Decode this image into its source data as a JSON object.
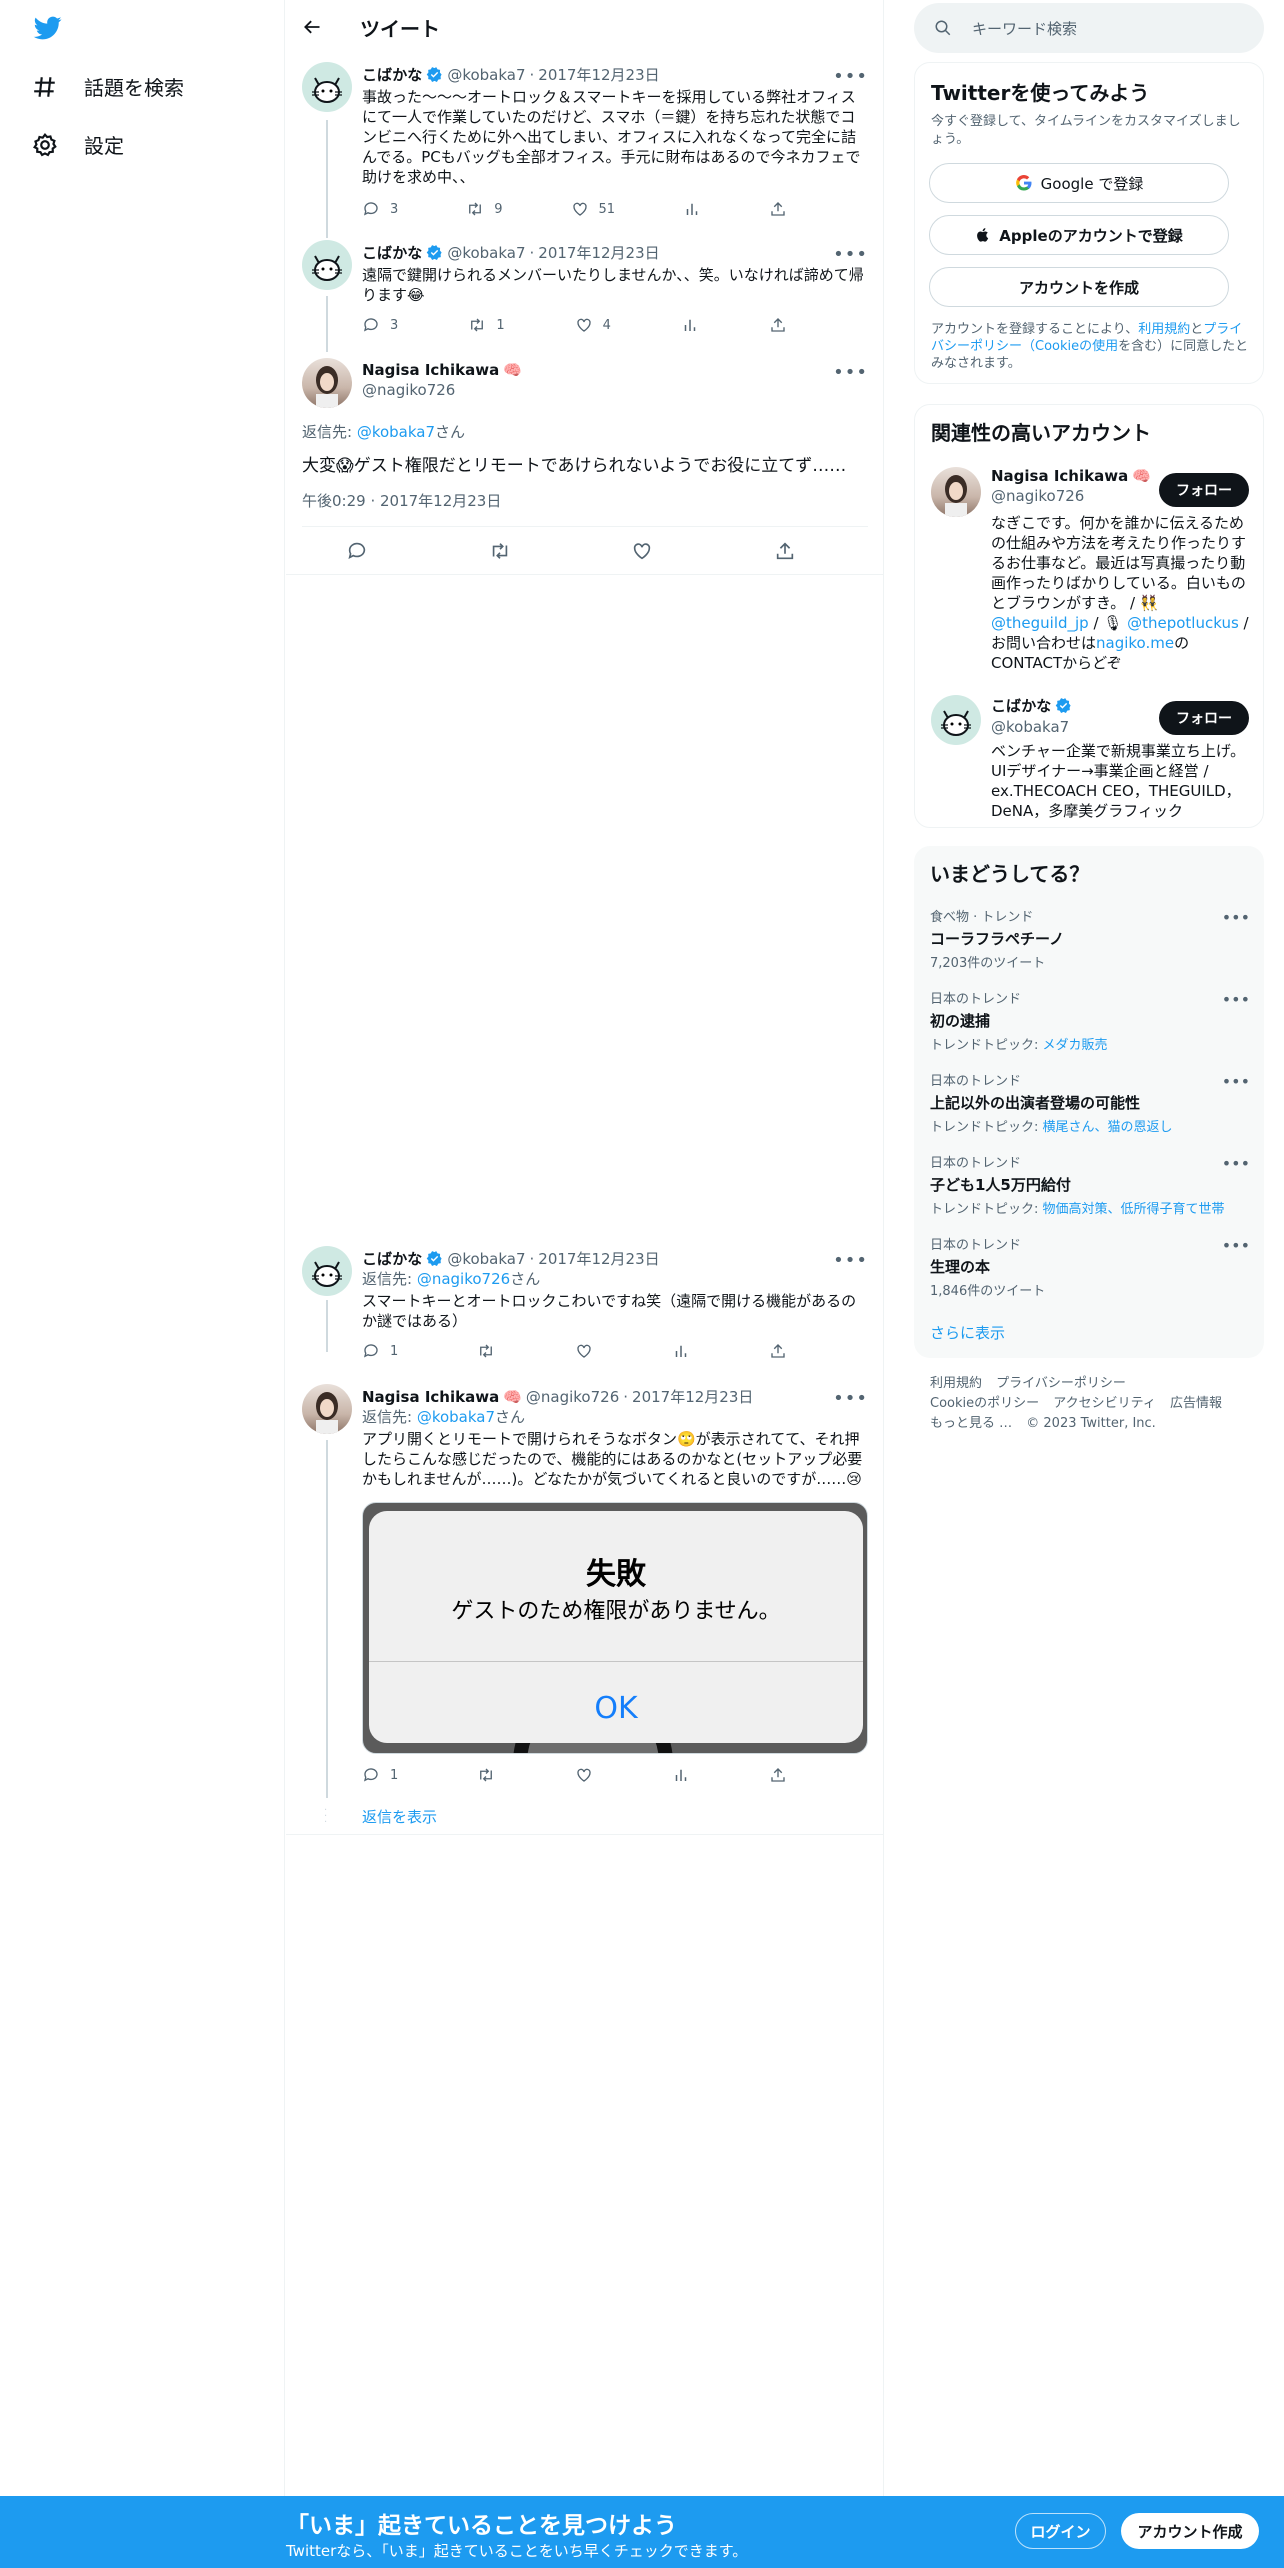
{
  "nav": {
    "explore_label": "話題を検索",
    "settings_label": "設定"
  },
  "header": {
    "title": "ツイート"
  },
  "tweets": [
    {
      "name": "こばかな",
      "handle": "@kobaka7",
      "date": "2017年12月23日",
      "text": "事故った〜〜〜オートロック＆スマートキーを採用している弊社オフィスにて一人で作業していたのだけど、スマホ（＝鍵）を持ち忘れた状態でコンビニへ行くために外へ出てしまい、オフィスに入れなくなって完全に詰んでる。PCもバッグも全部オフィス。手元に財布はあるので今ネカフェで助けを求め中、、",
      "replies": "3",
      "retweets": "9",
      "likes": "51"
    },
    {
      "name": "こばかな",
      "handle": "@kobaka7",
      "date": "2017年12月23日",
      "text": "遠隔で鍵開けられるメンバーいたりしませんか、、笑。いなければ諦めて帰ります😂",
      "replies": "3",
      "retweets": "1",
      "likes": "4"
    }
  ],
  "focus": {
    "name": "Nagisa Ichikawa",
    "emoji": "🧠",
    "handle": "@nagiko726",
    "reply_prefix": "返信先: ",
    "reply_to": "@kobaka7",
    "reply_suffix": "さん",
    "text": "大変😱ゲスト権限だとリモートであけられないようでお役に立てず……",
    "time": "午後0:29 · 2017年12月23日"
  },
  "replies": [
    {
      "name": "こばかな",
      "handle": "@kobaka7",
      "date": "2017年12月23日",
      "reply_prefix": "返信先: ",
      "reply_to": "@nagiko726",
      "reply_suffix": "さん",
      "text": "スマートキーとオートロックこわいですね笑（遠隔で開ける機能があるのか謎ではある）",
      "replies": "1"
    },
    {
      "name": "Nagisa Ichikawa",
      "emoji": "🧠",
      "handle": "@nagiko726",
      "date": "2017年12月23日",
      "reply_prefix": "返信先: ",
      "reply_to": "@kobaka7",
      "reply_suffix": "さん",
      "text": "アプリ開くとリモートで開けられそうなボタン🙄が表示されてて、それ押したらこんな感じだったので、機能的にはあるのかなと(セットアップ必要かもしれませんが……)。どなたかが気づいてくれると良いのですが……😢",
      "replies": "1",
      "media": {
        "alert_title": "失敗",
        "alert_message": "ゲストのため権限がありません。",
        "alert_button": "OK"
      }
    }
  ],
  "show_replies": "返信を表示",
  "search": {
    "placeholder": "キーワード検索"
  },
  "signup": {
    "title": "Twitterを使ってみよう",
    "subtitle": "今すぐ登録して、タイムラインをカスタマイズしましょう。",
    "google": "Google で登録",
    "apple": "Appleのアカウントで登録",
    "create": "アカウントを作成",
    "legal_1": "アカウントを登録することにより、",
    "legal_link_1": "利用規約",
    "legal_2": "と",
    "legal_link_2": "プライバシーポリシー（Cookieの使用",
    "legal_3": "を含む）に同意したとみなされます。"
  },
  "related": {
    "title": "関連性の高いアカウント",
    "accounts": [
      {
        "name": "Nagisa Ichikawa",
        "emoji": "🧠",
        "handle": "@nagiko726",
        "follow": "フォロー",
        "bio_1": "なぎこです。何かを誰かに伝えるための仕組みや方法を考えたり作ったりするお仕事など。最近は写真撮ったり動画作ったりばかりしている。白いものとブラウンがすき。 / 👯 ",
        "bio_link_1": "@theguild_jp",
        "bio_2": " / 🎙 ",
        "bio_link_2": "@thepotluckus",
        "bio_3": " / お問い合わせは",
        "bio_link_3": "nagiko.me",
        "bio_4": "のCONTACTからどぞ"
      },
      {
        "name": "こばかな",
        "handle": "@kobaka7",
        "follow": "フォロー",
        "bio": "ベンチャー企業で新規事業立ち上げ。UIデザイナー→事業企画と経営 / ex.THECOACH CEO，THEGUILD，DeNA，多摩美グラフィック"
      }
    ]
  },
  "trends": {
    "title": "いまどうしてる？",
    "items": [
      {
        "context": "食べ物 · トレンド",
        "name": "コーラフラペチーノ",
        "extra": "7,203件のツイート"
      },
      {
        "context": "日本のトレンド",
        "name": "初の逮捕",
        "extra_prefix": "トレンドトピック: ",
        "extra_link": "メダカ販売"
      },
      {
        "context": "日本のトレンド",
        "name": "上記以外の出演者登場の可能性",
        "extra_prefix": "トレンドトピック: ",
        "extra_link": "横尾さん、猫の恩返し"
      },
      {
        "context": "日本のトレンド",
        "name": "子ども1人5万円給付",
        "extra_prefix": "トレンドトピック: ",
        "extra_link": "物価高対策、低所得子育て世帯"
      },
      {
        "context": "日本のトレンド",
        "name": "生理の本",
        "extra": "1,846件のツイート"
      }
    ],
    "show_more": "さらに表示"
  },
  "footer": {
    "links_1": [
      "利用規約",
      "プライバシーポリシー"
    ],
    "links_2": [
      "Cookieのポリシー",
      "アクセシビリティ",
      "広告情報"
    ],
    "more": "もっと見る …",
    "copyright": "© 2023 Twitter, Inc."
  },
  "bottom": {
    "title": "「いま」起きていることを見つけよう",
    "subtitle": "Twitterなら、「いま」起きていることをいち早くチェックできます。",
    "login": "ログイン",
    "signup": "アカウント作成"
  },
  "colors": {
    "accent": "#1d9bf0",
    "text": "#0f1419",
    "muted": "#536471"
  }
}
